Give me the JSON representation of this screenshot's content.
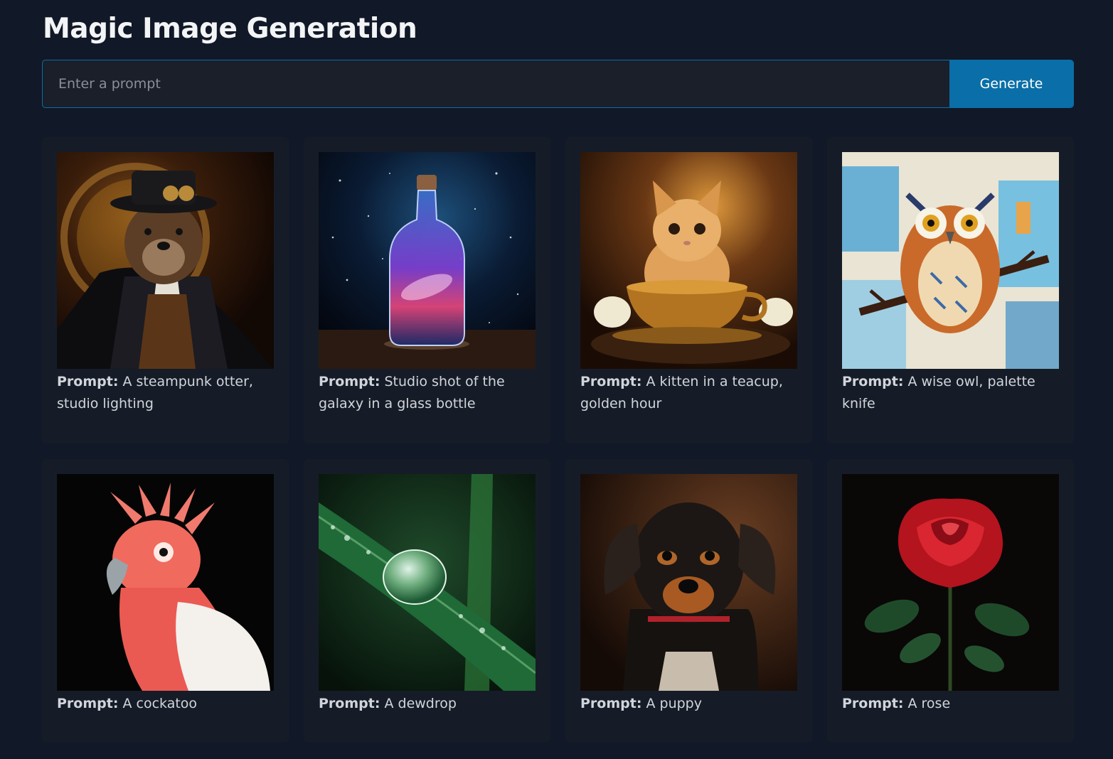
{
  "header": {
    "title": "Magic Image Generation"
  },
  "prompt_bar": {
    "placeholder": "Enter a prompt",
    "value": "",
    "button_label": "Generate"
  },
  "colors": {
    "background": "#111827",
    "card": "#161c27",
    "accent": "#0a6fa8"
  },
  "gallery": {
    "prompt_label": "Prompt:",
    "items": [
      {
        "prompt": "A steampunk otter, studio lighting",
        "image": "steampunk-otter-image"
      },
      {
        "prompt": "Studio shot of the galaxy in a glass bottle",
        "image": "galaxy-bottle-image"
      },
      {
        "prompt": "A kitten in a teacup, golden hour",
        "image": "kitten-teacup-image"
      },
      {
        "prompt": "A wise owl, palette knife",
        "image": "owl-painting-image"
      },
      {
        "prompt": "A cockatoo",
        "image": "cockatoo-image"
      },
      {
        "prompt": "A dewdrop",
        "image": "dewdrop-image"
      },
      {
        "prompt": "A puppy",
        "image": "puppy-image"
      },
      {
        "prompt": "A rose",
        "image": "rose-image"
      }
    ]
  }
}
